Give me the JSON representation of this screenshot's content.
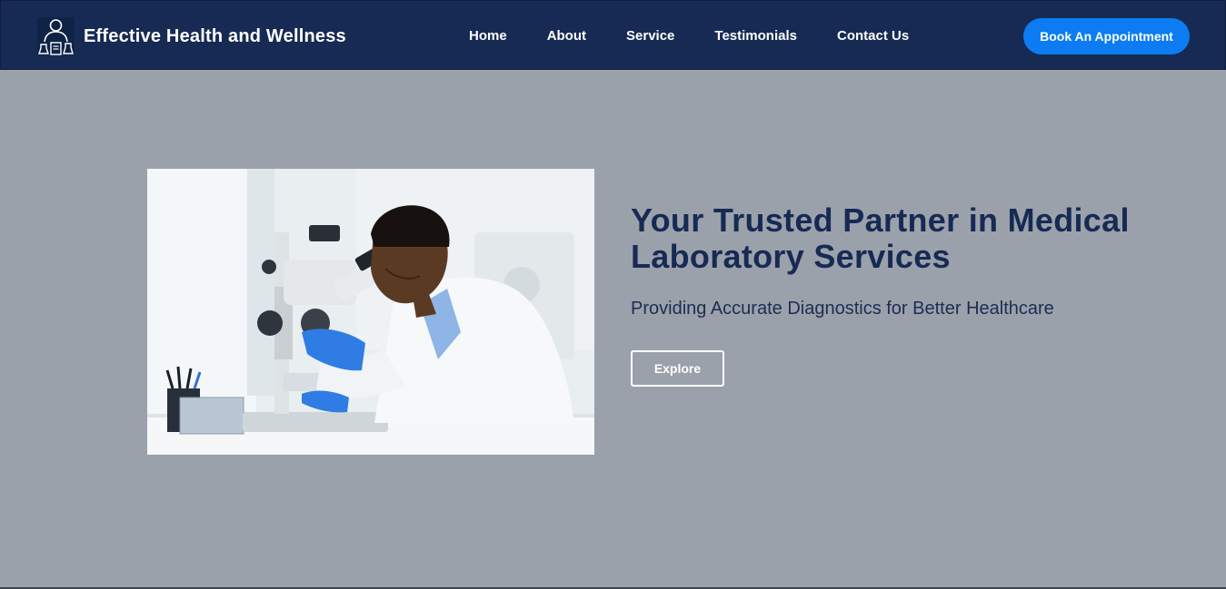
{
  "header": {
    "logo_icon": "lab-technician-logo-icon",
    "brand_name": "Effective Health and Wellness",
    "nav": [
      {
        "label": "Home"
      },
      {
        "label": "About"
      },
      {
        "label": "Service"
      },
      {
        "label": "Testimonials"
      },
      {
        "label": "Contact Us"
      }
    ],
    "cta_label": "Book An Appointment"
  },
  "hero": {
    "image_subject": "lab-scientist-microscope-photo",
    "title": "Your Trusted Partner in Medical Laboratory Services",
    "subtitle": "Providing Accurate Diagnostics for Better Healthcare",
    "button_label": "Explore"
  },
  "colors": {
    "nav_background": "#172a54",
    "accent_button": "#0d7cf2",
    "hero_background": "#9ba1ab",
    "title_color": "#172a54"
  }
}
